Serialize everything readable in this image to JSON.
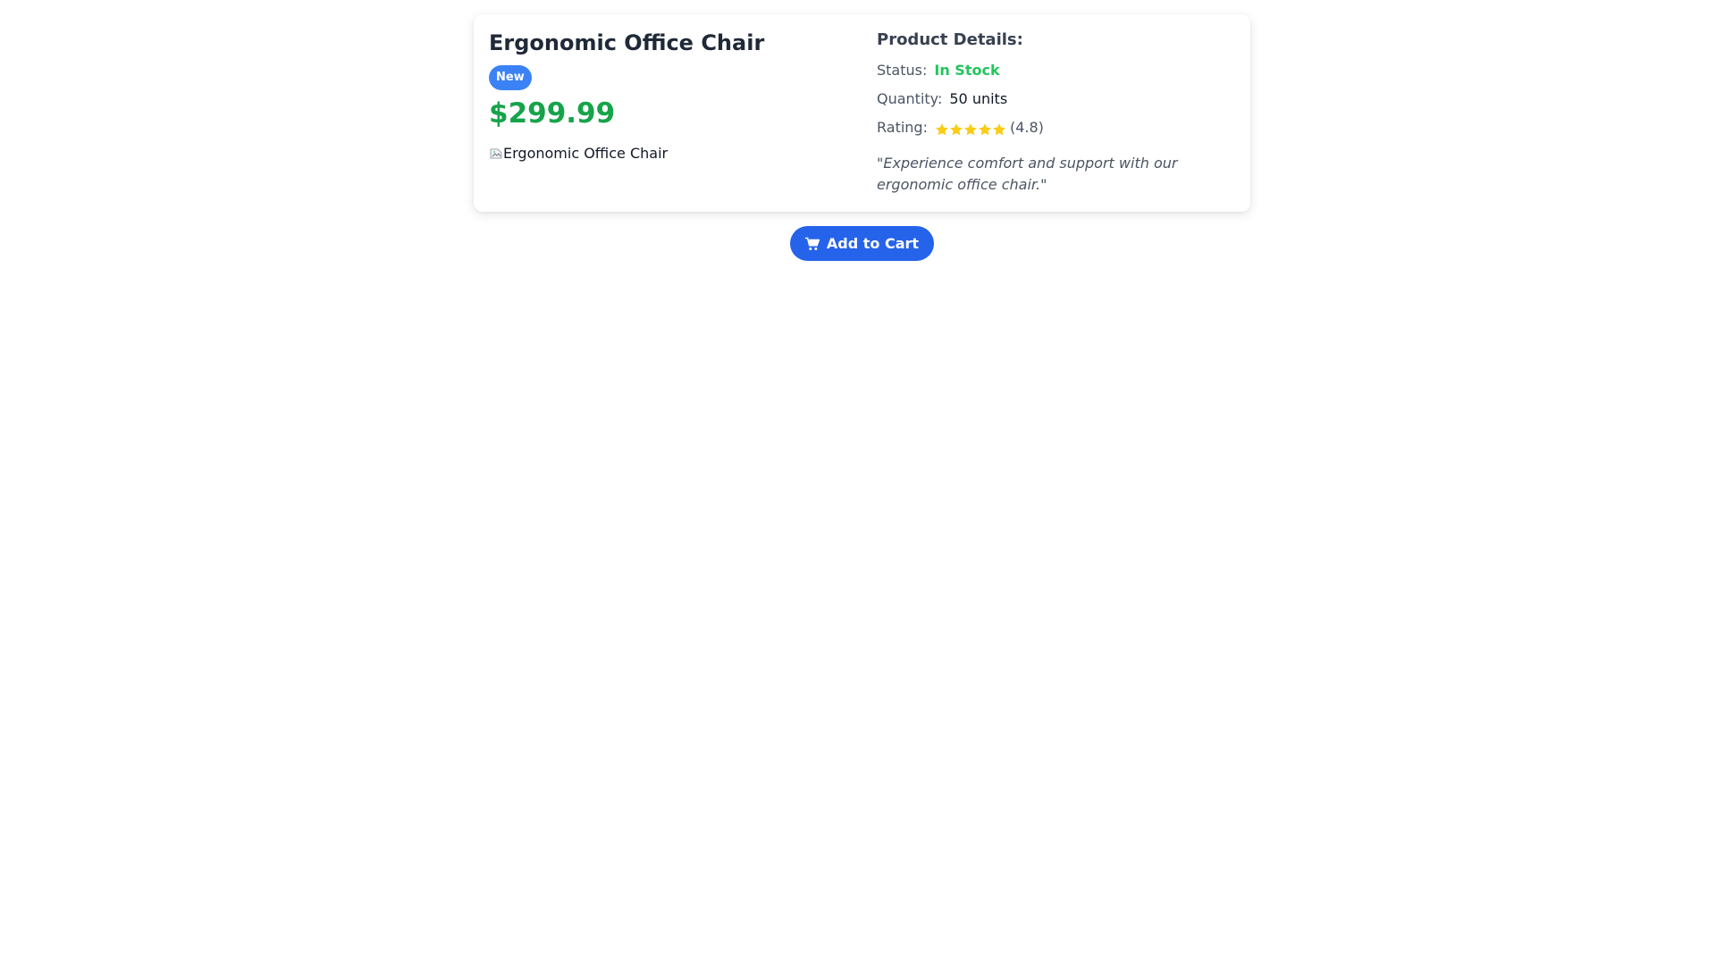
{
  "product": {
    "title": "Ergonomic Office Chair",
    "badge": "New",
    "price": "$299.99",
    "image_alt": "Ergonomic Office Chair"
  },
  "details": {
    "heading": "Product Details:",
    "status_label": "Status:",
    "status_value": "In Stock",
    "quantity_label": "Quantity:",
    "quantity_value": "50 units",
    "rating_label": "Rating:",
    "rating_stars": 5,
    "rating_value": "(4.8)",
    "quote": "\"Experience comfort and support with our ergonomic office chair.\""
  },
  "actions": {
    "add_to_cart_label": "Add to Cart"
  },
  "colors": {
    "accent": "#2563eb",
    "badge": "#3b82f6",
    "price": "#16a34a",
    "in_stock": "#22c55e",
    "star": "#facc15"
  },
  "icons": {
    "cart": "shopping-cart-icon",
    "star": "star-icon",
    "image": "broken-image-icon"
  }
}
